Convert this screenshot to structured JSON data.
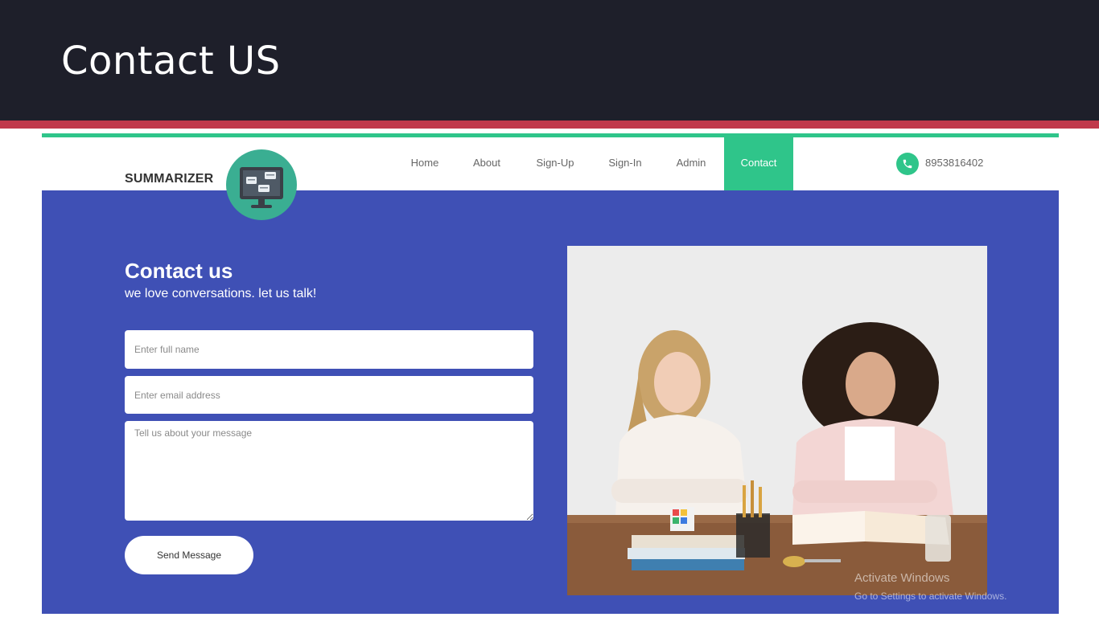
{
  "slide": {
    "title": "Contact US"
  },
  "site": {
    "brand": "SUMMARIZER",
    "nav": [
      {
        "label": "Home"
      },
      {
        "label": "About"
      },
      {
        "label": "Sign-Up"
      },
      {
        "label": "Sign-In"
      },
      {
        "label": "Admin"
      },
      {
        "label": "Contact",
        "active": true
      }
    ],
    "phone": "8953816402"
  },
  "contact_form": {
    "title": "Contact us",
    "subtitle": "we love conversations. let us talk!",
    "name_placeholder": "Enter full name",
    "email_placeholder": "Enter email address",
    "message_placeholder": "Tell us about your message",
    "send_label": "Send Message"
  },
  "watermark": {
    "line1": "Activate Windows",
    "line2": "Go to Settings to activate Windows."
  },
  "colors": {
    "slide_header": "#1e1f2a",
    "accent_bar": "#c0394b",
    "site_accent": "#2fc58a",
    "page_background": "#3f50b5"
  },
  "icons": {
    "logo": "monitor-chat-logo-icon",
    "phone": "phone-icon"
  }
}
